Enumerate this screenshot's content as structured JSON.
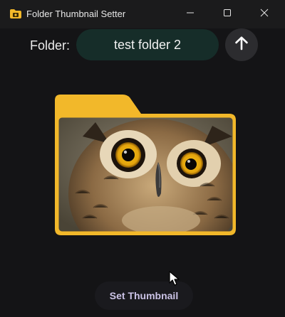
{
  "window": {
    "title": "Folder Thumbnail Setter",
    "controls": [
      "minimize",
      "maximize",
      "close"
    ]
  },
  "folder_row": {
    "label": "Folder:",
    "folder_name": "test folder 2",
    "up_button_icon": "arrow-up-icon"
  },
  "preview": {
    "frame_icon": "folder-icon",
    "thumbnail_subject": "owl photo"
  },
  "actions": {
    "set_thumbnail_label": "Set Thumbnail"
  },
  "colors": {
    "background": "#141416",
    "titlebar": "#1b1b1c",
    "folder_pill": "#162d29",
    "folder_yellow": "#f2b82a",
    "button_text": "#cbc3e6"
  }
}
